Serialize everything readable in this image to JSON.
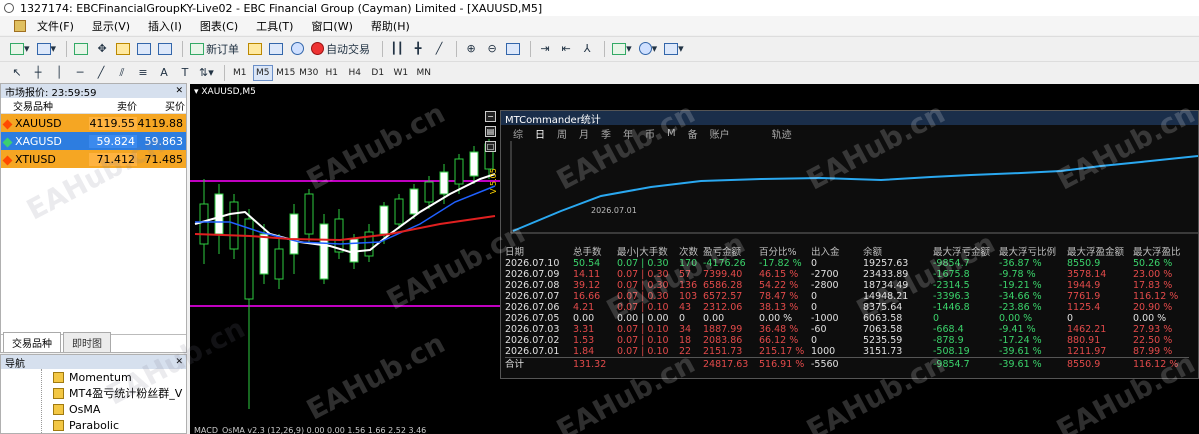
{
  "title": "1327174: EBCFinancialGroupKY-Live02 - EBC Financial Group (Cayman) Limited - [XAUUSD,M5]",
  "menu": [
    "文件(F)",
    "显示(V)",
    "插入(I)",
    "图表(C)",
    "工具(T)",
    "窗口(W)",
    "帮助(H)"
  ],
  "toolbar": {
    "new_order": "新订单",
    "auto_trade": "自动交易",
    "timeframes": [
      "M1",
      "M5",
      "M15",
      "M30",
      "H1",
      "H4",
      "D1",
      "W1",
      "MN"
    ],
    "active_timeframe": "M5",
    "text_tool": "A"
  },
  "market_watch": {
    "title": "市场报价: 23:59:59",
    "col_symbol": "交易品种",
    "col_bid": "卖价",
    "col_ask": "买价",
    "rows": [
      {
        "symbol": "XAUUSD",
        "bid": "4119.55",
        "ask": "4119.88",
        "color": "#f5a623"
      },
      {
        "symbol": "XAGUSD",
        "bid": "59.824",
        "ask": "59.863",
        "color": "#2d7de0"
      },
      {
        "symbol": "XTIUSD",
        "bid": "71.412",
        "ask": "71.485",
        "color": "#f5a623"
      }
    ],
    "tabs": [
      "交易品种",
      "即时图"
    ]
  },
  "navigator": {
    "title": "导航",
    "items": [
      "Momentum",
      "MT4盈亏统计粉丝群_V",
      "OsMA",
      "Parabolic"
    ]
  },
  "chart": {
    "label": "XAUUSD,M5",
    "price_tag": "V 5.05",
    "indicator": "MACD_OsMA v2.3 (12,26,9) 0.00 0.00 1.56 1.66 2.52 3.46"
  },
  "mtc": {
    "title": "MTCommander统计",
    "tabs": [
      "综",
      "日",
      "周",
      "月",
      "季",
      "年",
      "币",
      "M",
      "备",
      "账户",
      "轨迹"
    ],
    "active_tab": "日",
    "chart_date": "2026.07.01",
    "side_buttons": [
      "−",
      "▤",
      "□"
    ],
    "columns": [
      "日期",
      "总手数",
      "最小|大手数",
      "次数",
      "盈亏金额",
      "百分比%",
      "出入金",
      "余额",
      "最大浮亏金额",
      "最大浮亏比例",
      "最大浮盈金额",
      "最大浮盈比"
    ],
    "rows": [
      {
        "date": "2026.07.10",
        "lots": "50.54",
        "minmax": "0.07 | 0.30",
        "count": "170",
        "pnl": "-4176.26",
        "pct": "-17.82 %",
        "flow": "0",
        "balance": "19257.63",
        "maxloss": "-9854.7",
        "maxloss_pct": "-36.87 %",
        "maxprofit": "8550.9",
        "maxprofit_pct": "50.26 %",
        "sign": "pos"
      },
      {
        "date": "2026.07.09",
        "lots": "14.11",
        "minmax": "0.07 | 0.30",
        "count": "57",
        "pnl": "7399.40",
        "pct": "46.15 %",
        "flow": "-2700",
        "balance": "23433.89",
        "maxloss": "-1675.8",
        "maxloss_pct": "-9.78 %",
        "maxprofit": "3578.14",
        "maxprofit_pct": "23.00 %",
        "sign": "neg"
      },
      {
        "date": "2026.07.08",
        "lots": "39.12",
        "minmax": "0.07 | 0.30",
        "count": "136",
        "pnl": "6586.28",
        "pct": "54.22 %",
        "flow": "-2800",
        "balance": "18734.49",
        "maxloss": "-2314.5",
        "maxloss_pct": "-19.21 %",
        "maxprofit": "1944.9",
        "maxprofit_pct": "17.83 %",
        "sign": "neg"
      },
      {
        "date": "2026.07.07",
        "lots": "16.66",
        "minmax": "0.07 | 0.30",
        "count": "103",
        "pnl": "6572.57",
        "pct": "78.47 %",
        "flow": "0",
        "balance": "14948.21",
        "maxloss": "-3396.3",
        "maxloss_pct": "-34.66 %",
        "maxprofit": "7761.9",
        "maxprofit_pct": "116.12 %",
        "sign": "neg"
      },
      {
        "date": "2026.07.06",
        "lots": "4.21",
        "minmax": "0.07 | 0.10",
        "count": "43",
        "pnl": "2312.06",
        "pct": "38.13 %",
        "flow": "0",
        "balance": "8375.64",
        "maxloss": "-1446.8",
        "maxloss_pct": "-23.86 %",
        "maxprofit": "1125.4",
        "maxprofit_pct": "20.90 %",
        "sign": "neg"
      },
      {
        "date": "2026.07.05",
        "lots": "0.00",
        "minmax": "0.00 | 0.00",
        "count": "0",
        "pnl": "0.00",
        "pct": "0.00 %",
        "flow": "-1000",
        "balance": "6063.58",
        "maxloss": "0",
        "maxloss_pct": "0.00 %",
        "maxprofit": "0",
        "maxprofit_pct": "0.00 %",
        "sign": "neu"
      },
      {
        "date": "2026.07.03",
        "lots": "3.31",
        "minmax": "0.07 | 0.10",
        "count": "34",
        "pnl": "1887.99",
        "pct": "36.48 %",
        "flow": "-60",
        "balance": "7063.58",
        "maxloss": "-668.4",
        "maxloss_pct": "-9.41 %",
        "maxprofit": "1462.21",
        "maxprofit_pct": "27.93 %",
        "sign": "neg"
      },
      {
        "date": "2026.07.02",
        "lots": "1.53",
        "minmax": "0.07 | 0.10",
        "count": "18",
        "pnl": "2083.86",
        "pct": "66.12 %",
        "flow": "0",
        "balance": "5235.59",
        "maxloss": "-878.9",
        "maxloss_pct": "-17.24 %",
        "maxprofit": "880.91",
        "maxprofit_pct": "22.50 %",
        "sign": "neg"
      },
      {
        "date": "2026.07.01",
        "lots": "1.84",
        "minmax": "0.07 | 0.10",
        "count": "22",
        "pnl": "2151.73",
        "pct": "215.17 %",
        "flow": "1000",
        "balance": "3151.73",
        "maxloss": "-508.19",
        "maxloss_pct": "-39.61 %",
        "maxprofit": "1211.97",
        "maxprofit_pct": "87.99 %",
        "sign": "neg"
      }
    ],
    "total": {
      "date": "合计",
      "lots": "131.32",
      "minmax": "",
      "count": "",
      "pnl": "24817.63",
      "pct": "516.91 %",
      "flow": "-5560",
      "balance": "",
      "maxloss": "-9854.7",
      "maxloss_pct": "-39.61 %",
      "maxprofit": "8550.9",
      "maxprofit_pct": "116.12 %"
    }
  },
  "watermark": "EAHub.cn"
}
